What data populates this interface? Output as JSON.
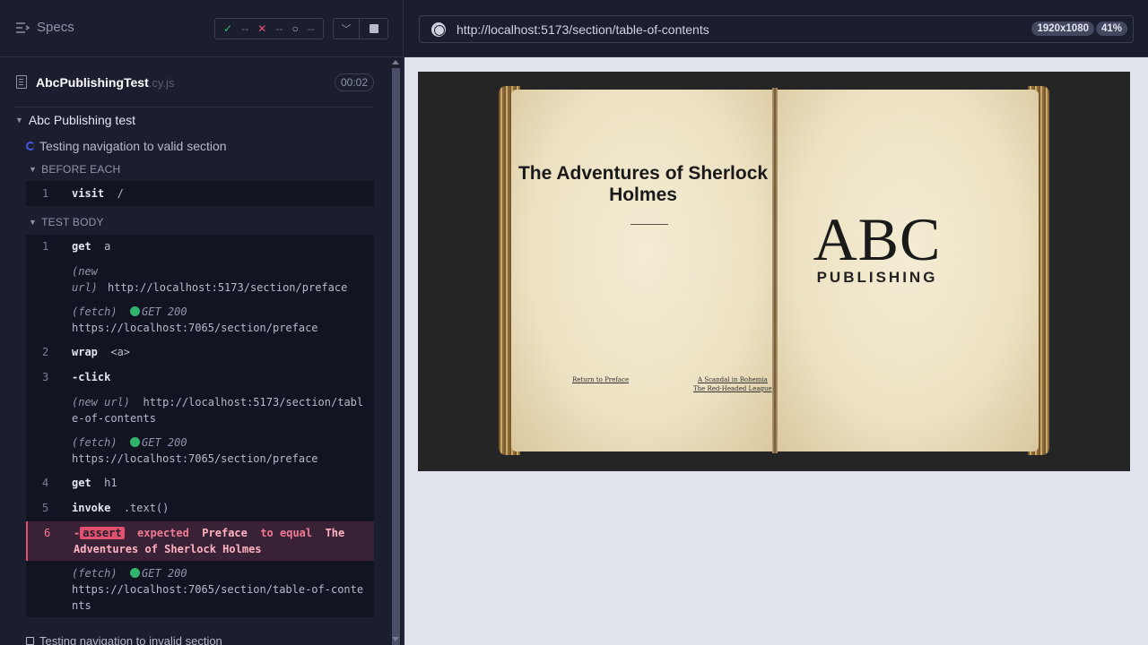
{
  "sidebar": {
    "specs_label": "Specs",
    "stats": {
      "passed": "--",
      "failed": "--",
      "pending": "--"
    },
    "file": {
      "name": "AbcPublishingTest",
      "ext": ".cy.js",
      "duration": "00:02"
    },
    "suite": "Abc Publishing test",
    "test_running": "Testing navigation to valid section",
    "hooks": {
      "before_each": "BEFORE EACH",
      "test_body": "TEST BODY"
    },
    "before_each_cmd": {
      "num": "1",
      "cmd": "visit",
      "arg": "/"
    },
    "commands": [
      {
        "num": "1",
        "cmd": "get",
        "arg": "a"
      },
      {
        "label": "(new url)",
        "value": "http://localhost:5173/section/preface"
      },
      {
        "label": "(fetch)",
        "method": "GET 200",
        "value": "https://localhost:7065/section/preface"
      },
      {
        "num": "2",
        "cmd": "wrap",
        "arg": "<a>"
      },
      {
        "num": "3",
        "cmd": "-click"
      },
      {
        "label": "(new url)",
        "value": "http://localhost:5173/section/table-of-contents"
      },
      {
        "label": "(fetch)",
        "method": "GET 200",
        "value": "https://localhost:7065/section/preface"
      },
      {
        "num": "4",
        "cmd": "get",
        "arg": "h1"
      },
      {
        "num": "5",
        "cmd": "invoke",
        "arg": ".text()"
      },
      {
        "num": "6",
        "badge": "assert",
        "a": "expected",
        "b": "Preface",
        "c": "to equal",
        "d": "The Adventures of Sherlock Holmes"
      },
      {
        "label": "(fetch)",
        "method": "GET 200",
        "value": "https://localhost:7065/section/table-of-contents"
      }
    ],
    "next_test": "Testing navigation to invalid section"
  },
  "preview": {
    "url": "http://localhost:5173/section/table-of-contents",
    "viewport": "1920x1080",
    "zoom": "41%",
    "book": {
      "title": "The Adventures of Sherlock Holmes",
      "link_prev": "Return to Preface",
      "links_next": [
        "A Scandal in Bohemia",
        "The Red-Headed League"
      ],
      "logo_main": "ABC",
      "logo_sub": "PUBLISHING"
    }
  },
  "colors": {
    "pass": "#31b26d",
    "fail": "#e2506e",
    "accent": "#4956e3"
  }
}
